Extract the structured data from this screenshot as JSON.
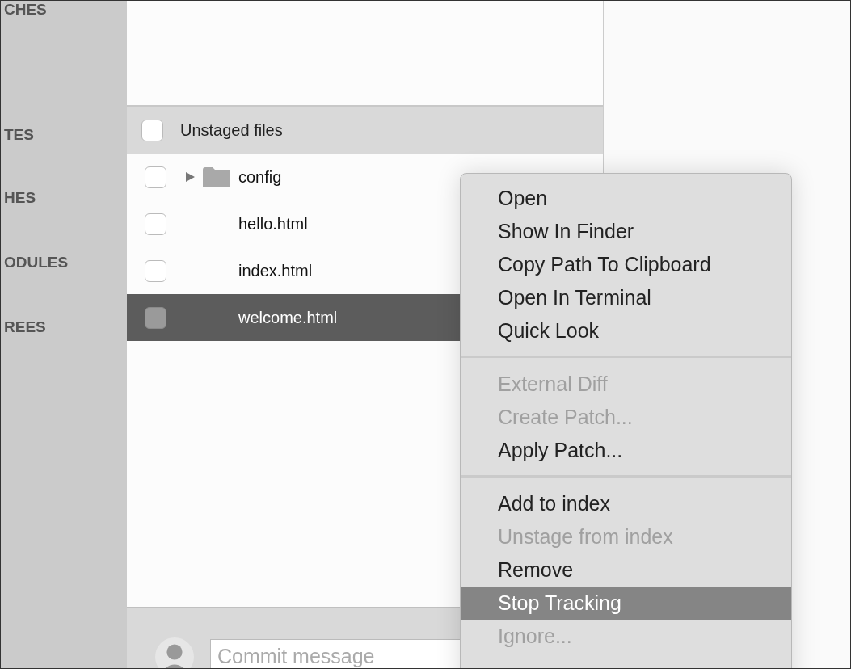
{
  "sidebar": {
    "sections": [
      "CHES",
      "TES",
      "HES",
      "ODULES",
      "REES"
    ]
  },
  "unstaged": {
    "title": "Unstaged files",
    "checked": false,
    "files": [
      {
        "name": "config",
        "kind": "folder",
        "checked": false,
        "selected": false,
        "expanded": false
      },
      {
        "name": "hello.html",
        "kind": "file",
        "checked": false,
        "selected": false
      },
      {
        "name": "index.html",
        "kind": "file",
        "checked": false,
        "selected": false
      },
      {
        "name": "welcome.html",
        "kind": "file",
        "checked": false,
        "selected": true
      }
    ]
  },
  "commit": {
    "placeholder": "Commit message"
  },
  "context_menu": {
    "groups": [
      [
        {
          "label": "Open",
          "disabled": false,
          "selected": false
        },
        {
          "label": "Show In Finder",
          "disabled": false,
          "selected": false
        },
        {
          "label": "Copy Path To Clipboard",
          "disabled": false,
          "selected": false
        },
        {
          "label": "Open In Terminal",
          "disabled": false,
          "selected": false
        },
        {
          "label": "Quick Look",
          "disabled": false,
          "selected": false
        }
      ],
      [
        {
          "label": "External Diff",
          "disabled": true,
          "selected": false
        },
        {
          "label": "Create Patch...",
          "disabled": true,
          "selected": false
        },
        {
          "label": "Apply Patch...",
          "disabled": false,
          "selected": false
        }
      ],
      [
        {
          "label": "Add to index",
          "disabled": false,
          "selected": false
        },
        {
          "label": "Unstage from index",
          "disabled": true,
          "selected": false
        },
        {
          "label": "Remove",
          "disabled": false,
          "selected": false
        },
        {
          "label": "Stop Tracking",
          "disabled": false,
          "selected": true
        },
        {
          "label": "Ignore...",
          "disabled": true,
          "selected": false
        }
      ]
    ]
  }
}
